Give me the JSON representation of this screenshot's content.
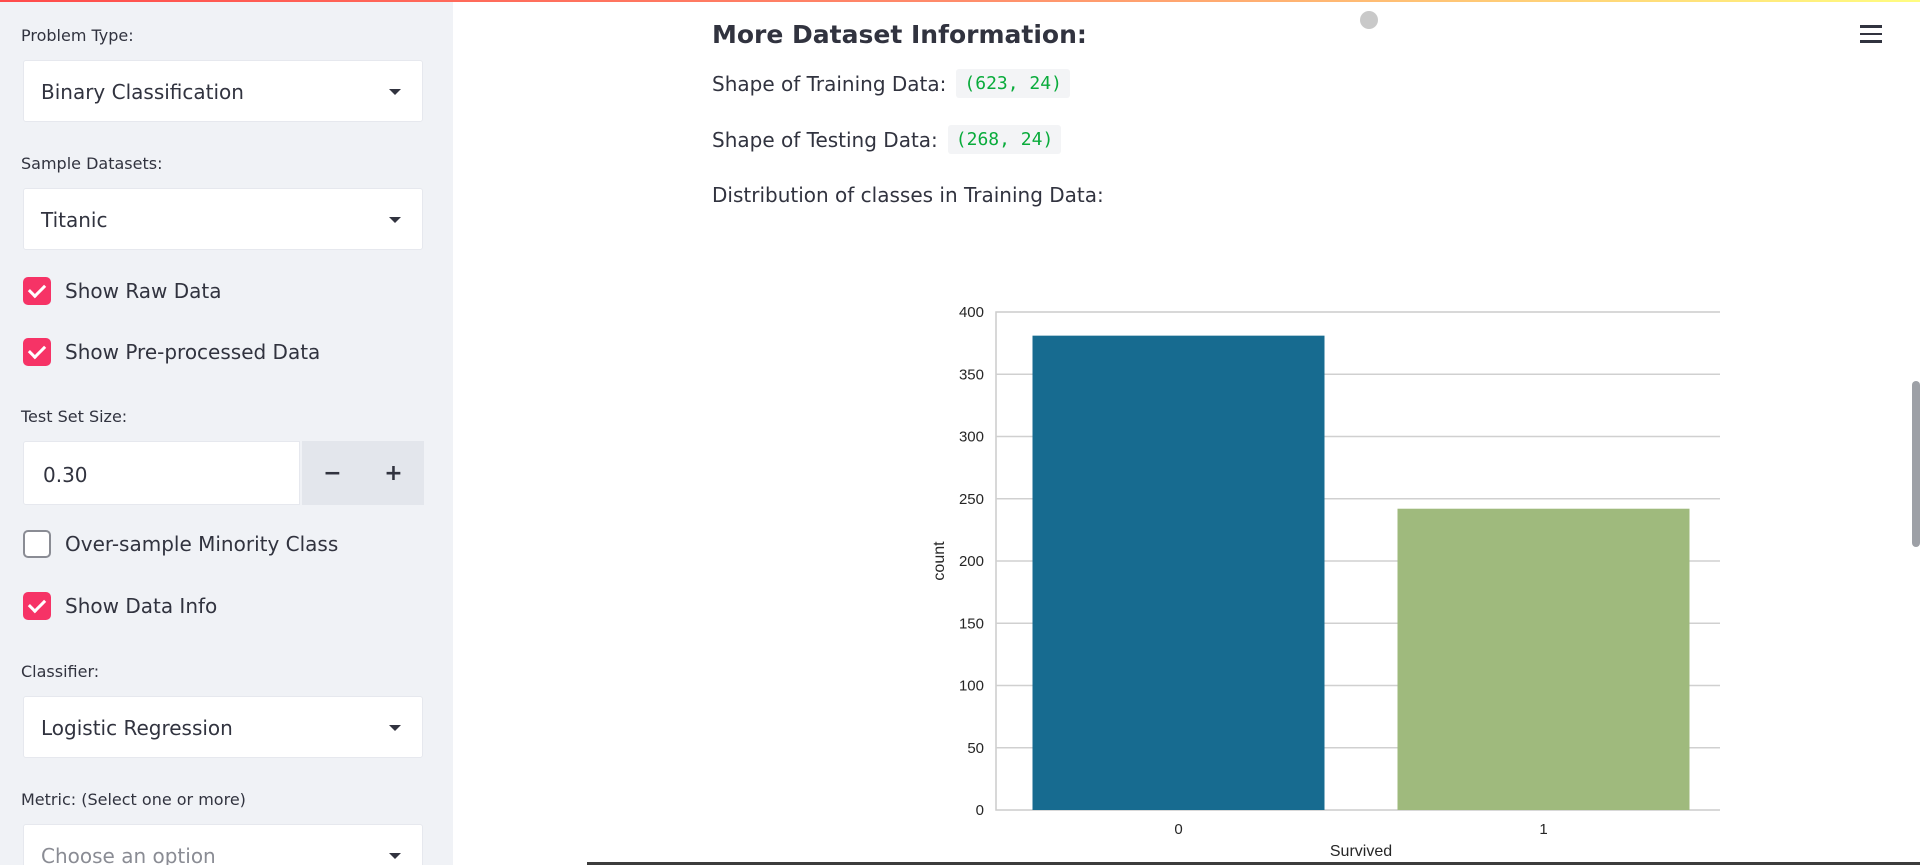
{
  "sidebar": {
    "problem_type": {
      "label": "Problem Type:",
      "value": "Binary Classification"
    },
    "sample_datasets": {
      "label": "Sample Datasets:",
      "value": "Titanic"
    },
    "checkboxes": {
      "show_raw": {
        "label": "Show Raw Data",
        "checked": true
      },
      "show_preprocessed": {
        "label": "Show Pre-processed Data",
        "checked": true
      },
      "oversample": {
        "label": "Over-sample Minority Class",
        "checked": false
      },
      "show_info": {
        "label": "Show Data Info",
        "checked": true
      }
    },
    "test_set_size": {
      "label": "Test Set Size:",
      "value": "0.30",
      "minus": "−",
      "plus": "+"
    },
    "classifier": {
      "label": "Classifier:",
      "value": "Logistic Regression"
    },
    "metric": {
      "label": "Metric: (Select one or more)",
      "placeholder": "Choose an option"
    }
  },
  "main": {
    "heading": "More Dataset Information:",
    "training_shape": {
      "label": "Shape of Training Data:",
      "value": "(623, 24)"
    },
    "testing_shape": {
      "label": "Shape of Testing Data:",
      "value": "(268, 24)"
    },
    "distribution_label": "Distribution of classes in Training Data:"
  },
  "icons": {
    "menu": "hamburger-menu-icon",
    "status": "running-status-icon"
  },
  "colors": {
    "accent": "#f63366",
    "code_text": "#09ab3b",
    "bar_0": "#176b90",
    "bar_1": "#9fba7d"
  },
  "chart_data": {
    "type": "bar",
    "categories": [
      "0",
      "1"
    ],
    "values": [
      381,
      242
    ],
    "xlabel": "Survived",
    "ylabel": "count",
    "ylim": [
      0,
      400
    ],
    "yticks": [
      0,
      50,
      100,
      150,
      200,
      250,
      300,
      350,
      400
    ],
    "grid": true
  }
}
